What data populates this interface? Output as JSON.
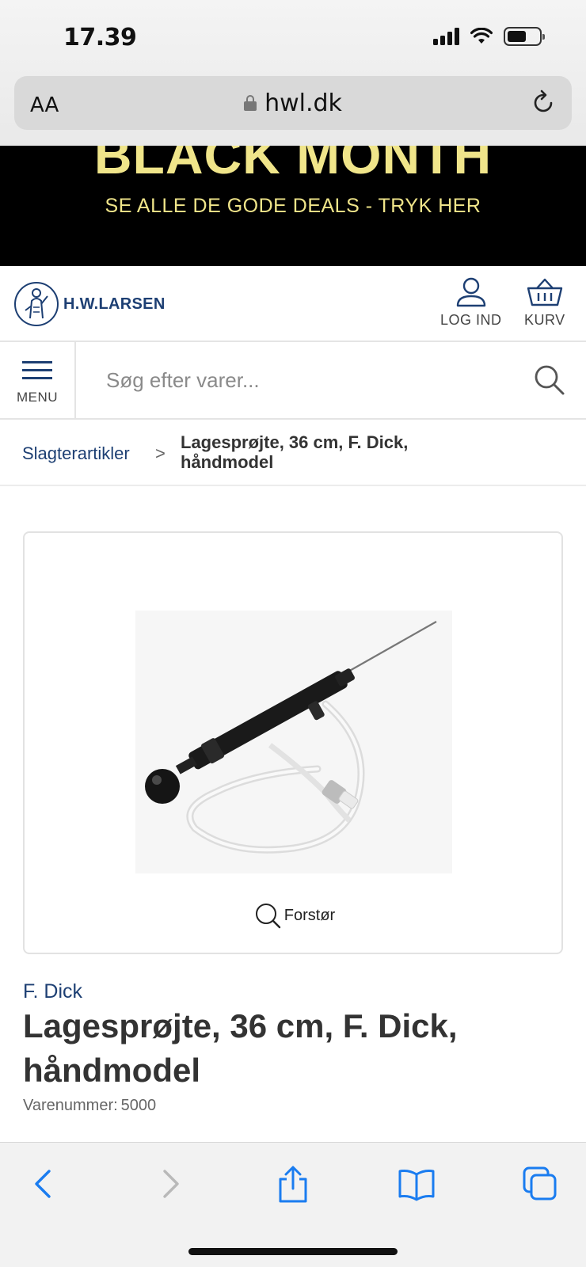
{
  "status_bar": {
    "time": "17.39"
  },
  "browser": {
    "text_size_label": "AA",
    "url": "hwl.dk"
  },
  "banner": {
    "title": "BLACK MONTH",
    "subtitle": "SE ALLE DE GODE DEALS - TRYK HER",
    "text_color": "#f0e58a"
  },
  "header": {
    "logo_text": "H.W.LARSEN",
    "login_label": "LOG IND",
    "cart_label": "KURV",
    "brand_color": "#1d3f73"
  },
  "search": {
    "menu_label": "MENU",
    "placeholder": "Søg efter varer..."
  },
  "breadcrumb": {
    "parent": "Slagterartikler",
    "separator": ">",
    "current": "Lagesprøjte, 36 cm, F. Dick, håndmodel"
  },
  "product": {
    "zoom_label": "Forstør",
    "brand": "F. Dick",
    "title": "Lagesprøjte, 36 cm, F. Dick, håndmodel",
    "sku_label": "Varenummer:",
    "sku": "5000"
  },
  "toolbar": {
    "icons": [
      "back-icon",
      "forward-icon",
      "share-icon",
      "bookmarks-icon",
      "tabs-icon"
    ],
    "accent": "#1a7cf0"
  }
}
